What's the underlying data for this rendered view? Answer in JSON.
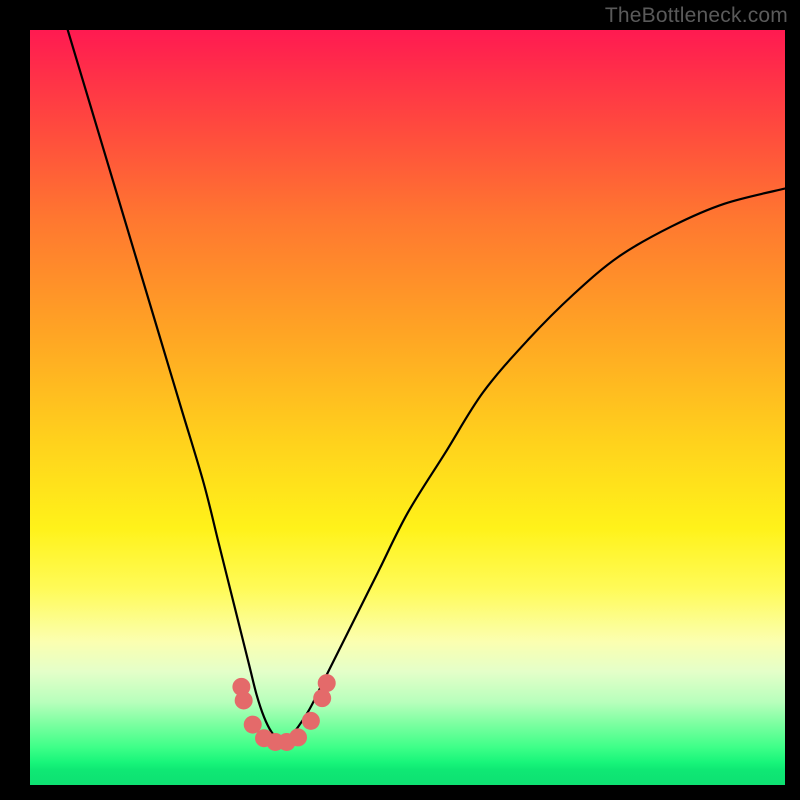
{
  "watermark": "TheBottleneck.com",
  "chart_data": {
    "type": "line",
    "title": "",
    "xlabel": "",
    "ylabel": "",
    "xlim": [
      0,
      100
    ],
    "ylim": [
      0,
      100
    ],
    "grid": false,
    "legend": false,
    "series": [
      {
        "name": "bottleneck-curve",
        "x": [
          5,
          8,
          11,
          14,
          17,
          20,
          23,
          25,
          27,
          29,
          30,
          31,
          32,
          33,
          34,
          35,
          37,
          39,
          42,
          46,
          50,
          55,
          60,
          66,
          72,
          78,
          85,
          92,
          100
        ],
        "y": [
          100,
          90,
          80,
          70,
          60,
          50,
          40,
          32,
          24,
          16,
          12,
          9,
          7,
          6,
          6,
          7,
          10,
          14,
          20,
          28,
          36,
          44,
          52,
          59,
          65,
          70,
          74,
          77,
          79
        ]
      }
    ],
    "markers": [
      {
        "name": "dot",
        "x": 28.0,
        "y": 13.0
      },
      {
        "name": "dot",
        "x": 28.3,
        "y": 11.2
      },
      {
        "name": "dot",
        "x": 29.5,
        "y": 8.0
      },
      {
        "name": "dot",
        "x": 31.0,
        "y": 6.2
      },
      {
        "name": "dot",
        "x": 32.5,
        "y": 5.7
      },
      {
        "name": "dot",
        "x": 34.0,
        "y": 5.7
      },
      {
        "name": "dot",
        "x": 35.5,
        "y": 6.3
      },
      {
        "name": "dot",
        "x": 37.2,
        "y": 8.5
      },
      {
        "name": "dot",
        "x": 38.7,
        "y": 11.5
      },
      {
        "name": "dot",
        "x": 39.3,
        "y": 13.5
      }
    ],
    "marker_color": "#e46a6a",
    "curve_color": "#000000"
  }
}
